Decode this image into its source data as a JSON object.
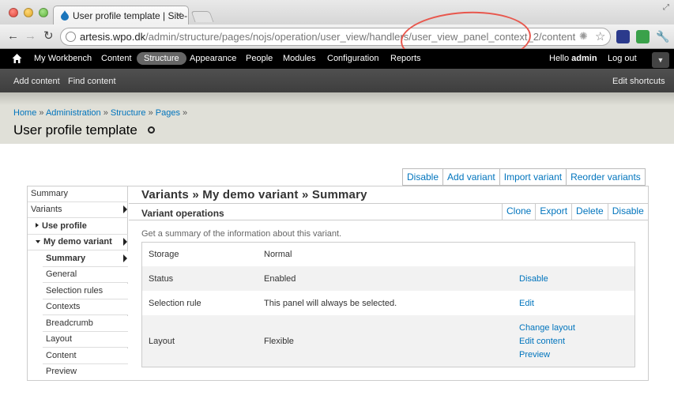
{
  "browser": {
    "tab_title": "User profile template | Site-I",
    "url_host": "artesis.wpo.dk",
    "url_path": "/admin/structure/pages/nojs/operation/user_view/handlers/user_view_panel_context_2/content"
  },
  "admin_menu": {
    "items": [
      "My Workbench",
      "Content",
      "Structure",
      "Appearance",
      "People",
      "Modules",
      "Configuration",
      "Reports"
    ],
    "active": "Structure",
    "hello": "Hello",
    "user": "admin",
    "logout": "Log out"
  },
  "shortcuts": {
    "items": [
      "Add content",
      "Find content"
    ],
    "edit": "Edit shortcuts"
  },
  "breadcrumb": [
    "Home",
    "Administration",
    "Structure",
    "Pages"
  ],
  "page_title": "User profile template",
  "top_actions": [
    "Disable",
    "Add variant",
    "Import variant",
    "Reorder variants"
  ],
  "sidebar": {
    "summary": "Summary",
    "variants": "Variants",
    "use_profile": "Use profile",
    "my_demo_variant": "My demo variant",
    "sub_items": [
      "Summary",
      "General",
      "Selection rules",
      "Contexts",
      "Breadcrumb",
      "Layout",
      "Content",
      "Preview"
    ]
  },
  "content": {
    "title": "Variants » My demo variant » Summary",
    "subtitle": "Variant operations",
    "operations": [
      "Clone",
      "Export",
      "Delete",
      "Disable"
    ],
    "description": "Get a summary of the information about this variant.",
    "rows": [
      {
        "label": "Storage",
        "value": "Normal",
        "links": []
      },
      {
        "label": "Status",
        "value": "Enabled",
        "links": [
          "Disable"
        ]
      },
      {
        "label": "Selection rule",
        "value": "This panel will always be selected.",
        "links": [
          "Edit"
        ]
      },
      {
        "label": "Layout",
        "value": "Flexible",
        "links": [
          "Change layout",
          "Edit content",
          "Preview"
        ]
      }
    ]
  },
  "colors": {
    "link": "#0074bd",
    "admin_bar": "#000000",
    "annotation": "#e8574d"
  }
}
